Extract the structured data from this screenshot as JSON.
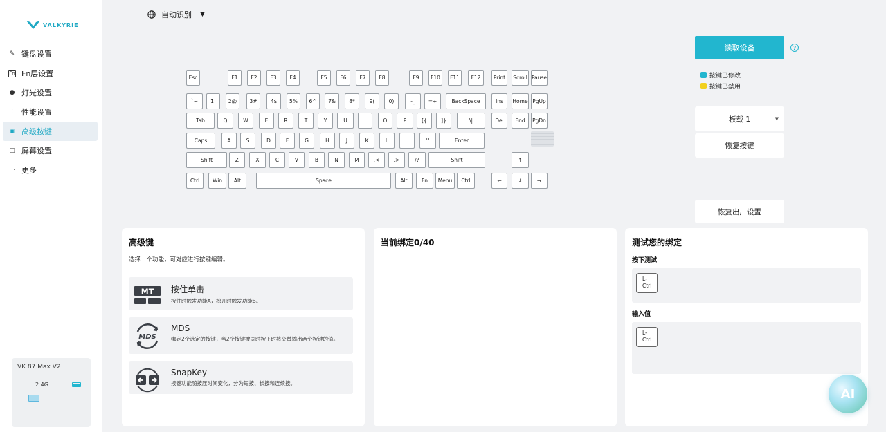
{
  "brand": {
    "name": "VALKYRIE"
  },
  "language": {
    "label": "自动识别"
  },
  "nav": {
    "items": [
      {
        "label": "键盘设置",
        "icon": "pencil-icon"
      },
      {
        "label": "Fn层设置",
        "icon": "fn-icon"
      },
      {
        "label": "灯光设置",
        "icon": "bulb-icon"
      },
      {
        "label": "性能设置",
        "icon": "sliders-icon"
      },
      {
        "label": "高级按键",
        "icon": "advanced-key-icon",
        "active": true
      },
      {
        "label": "屏幕设置",
        "icon": "screen-icon"
      },
      {
        "label": "更多",
        "icon": "more-icon"
      }
    ]
  },
  "device": {
    "name": "VK 87 Max V2",
    "connection": "2.4G",
    "keyboard_label": ""
  },
  "keyboard": {
    "rows": [
      [
        "Esc",
        "F1",
        "F2",
        "F3",
        "F4",
        "F5",
        "F6",
        "F7",
        "F8",
        "F9",
        "F10",
        "F11",
        "F12",
        "Print",
        "Scroll",
        "Pause"
      ],
      [
        "`~",
        "1!",
        "2@",
        "3#",
        "4$",
        "5%",
        "6^",
        "7&",
        "8*",
        "9(",
        "0)",
        "-_",
        "=+",
        "BackSpace",
        "Ins",
        "Home",
        "PgUp"
      ],
      [
        "Tab",
        "Q",
        "W",
        "E",
        "R",
        "T",
        "Y",
        "U",
        "I",
        "O",
        "P",
        "[{",
        "]}",
        "\\|",
        "Del",
        "End",
        "PgDn"
      ],
      [
        "Caps",
        "A",
        "S",
        "D",
        "F",
        "G",
        "H",
        "J",
        "K",
        "L",
        ";:",
        "'\"",
        "Enter"
      ],
      [
        "Shift",
        "Z",
        "X",
        "C",
        "V",
        "B",
        "N",
        "M",
        ",<",
        ".>",
        "/?",
        "Shift",
        "↑"
      ],
      [
        "Ctrl",
        "Win",
        "Alt",
        "Space",
        "Alt",
        "Fn",
        "Menu",
        "Ctrl",
        "←",
        "↓",
        "→"
      ]
    ]
  },
  "actions": {
    "read_device": "读取设备",
    "restore_keys": "恢复按键",
    "factory_reset": "恢复出厂设置",
    "profile_select": "板载 1"
  },
  "legend": [
    {
      "label": "按键已修改",
      "color": "#22b6cf"
    },
    {
      "label": "按键已禁用",
      "color": "#f2d01e"
    }
  ],
  "advanced_panel": {
    "title": "高级键",
    "subtitle": "选择一个功能，可对应进行按键编辑。",
    "features": [
      {
        "title": "按住单击",
        "desc": "按住时触发功能A，松开时触发功能B。",
        "icon": "mt-icon",
        "icon_text": "MT"
      },
      {
        "title": "MDS",
        "desc": "绑定2个选定的按键，当2个按键被同时按下时将交替输出两个按键的值。",
        "icon": "mds-icon",
        "icon_text": "MDS"
      },
      {
        "title": "SnapKey",
        "desc": "按键功能随按压时间变化，分为短按、长按和连续按。",
        "icon": "snapkey-icon"
      }
    ]
  },
  "binding_panel": {
    "title": "当前绑定0/40"
  },
  "test_panel": {
    "title": "测试您的绑定",
    "press_label": "按下测试",
    "press_key": [
      "L-",
      "Ctrl"
    ],
    "input_label": "输入值",
    "input_key": [
      "L-",
      "Ctrl"
    ]
  },
  "ai": {
    "label": "AI"
  }
}
